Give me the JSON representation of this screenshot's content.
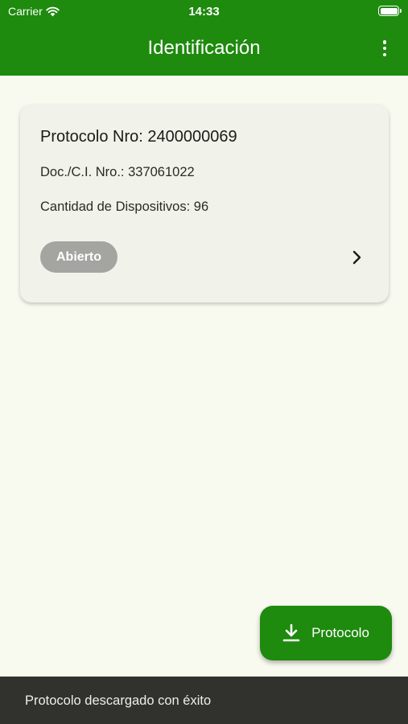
{
  "status_bar": {
    "carrier": "Carrier",
    "time": "14:33"
  },
  "app_bar": {
    "title": "Identificación"
  },
  "protocol_card": {
    "title": "Protocolo Nro: 2400000069",
    "doc": "Doc./C.I. Nro.: 337061022",
    "device_count": "Cantidad de Dispositivos: 96",
    "status": "Abierto"
  },
  "fab": {
    "label": "Protocolo"
  },
  "snackbar": {
    "message": "Protocolo descargado con éxito"
  },
  "colors": {
    "primary": "#1e8a0e",
    "background": "#f8faf0",
    "card": "#f1f2ea",
    "chip": "#a4a5a1",
    "snackbar": "#31322e"
  },
  "icons": [
    "wifi-icon",
    "battery-icon",
    "more-vertical-icon",
    "chevron-right-icon",
    "download-icon"
  ]
}
